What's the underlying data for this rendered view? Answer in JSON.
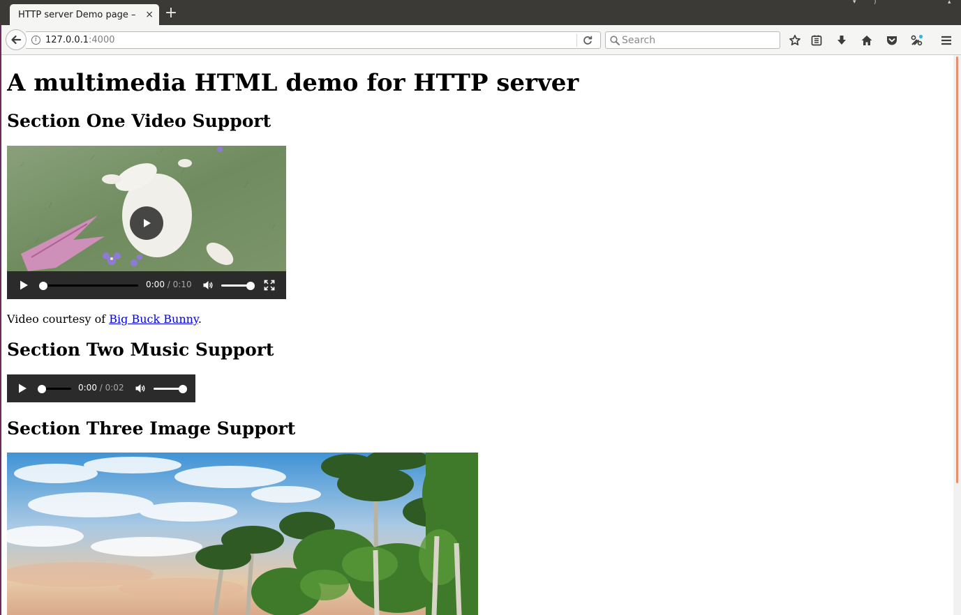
{
  "browser": {
    "tab_title": "HTTP server Demo page –",
    "tab_close": "×",
    "new_tab": "+",
    "url_host": "127.0.0.1",
    "url_port": ":4000",
    "search_placeholder": "Search"
  },
  "page": {
    "title": "A multimedia HTML demo for HTTP server",
    "section_one": "Section One Video Support",
    "section_two": "Section Two Music Support",
    "section_three": "Section Three Image Support",
    "caption_prefix": "Video courtesy of ",
    "caption_link": "Big Buck Bunny",
    "caption_suffix": "."
  },
  "video": {
    "current_time": "0:00",
    "separator": " / ",
    "duration": "0:10",
    "progress": 0,
    "volume": 1
  },
  "audio": {
    "current_time": "0:00",
    "separator": " / ",
    "duration": "0:02",
    "progress": 0,
    "volume": 1
  },
  "colors": {
    "link": "#0000ee",
    "tabbar": "#3b3a36",
    "toolbar": "#f5f5f4",
    "player": "#2b2b2b",
    "scroll_accent": "#e8906b"
  },
  "icons": [
    "back-arrow-icon",
    "info-icon",
    "reload-icon",
    "search-icon",
    "bookmark-star-icon",
    "reading-list-icon",
    "download-icon",
    "home-icon",
    "pocket-icon",
    "extension-icon",
    "hamburger-menu-icon",
    "play-icon",
    "volume-icon",
    "fullscreen-icon"
  ]
}
